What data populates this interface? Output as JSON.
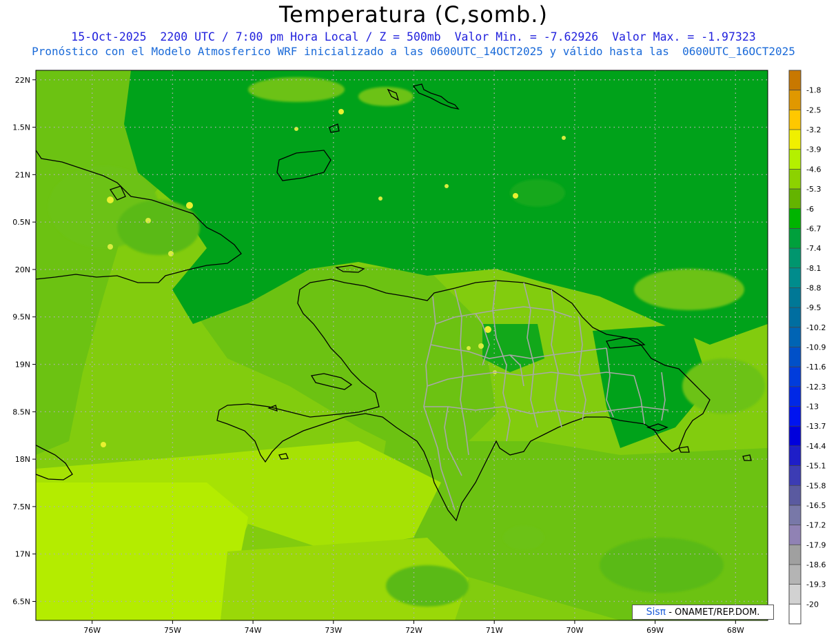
{
  "title": "Temperatura (C,somb.)",
  "subtitle_line1": "15-Oct-2025  2200 UTC / 7:00 pm Hora Local / Z = 500mb  Valor Min. = -7.62926  Valor Max. = -1.97323",
  "subtitle_line2": "Pronóstico con el Modelo Atmosferico WRF inicializado a las 0600UTC_14OCT2025 y válido hasta las  0600UTC_16OCT2025",
  "credit_brand": "Sisπ",
  "credit_text": " - ONAMET/REP.DOM.",
  "map": {
    "lon_range": [
      -76.7,
      -67.6
    ],
    "lat_range": [
      16.3,
      22.1
    ],
    "lat_ticks": [
      {
        "value": 22.0,
        "label": "22N"
      },
      {
        "value": 21.5,
        "label": "1.5N"
      },
      {
        "value": 21.0,
        "label": "21N"
      },
      {
        "value": 20.5,
        "label": "0.5N"
      },
      {
        "value": 20.0,
        "label": "20N"
      },
      {
        "value": 19.5,
        "label": "9.5N"
      },
      {
        "value": 19.0,
        "label": "19N"
      },
      {
        "value": 18.5,
        "label": "8.5N"
      },
      {
        "value": 18.0,
        "label": "18N"
      },
      {
        "value": 17.5,
        "label": "7.5N"
      },
      {
        "value": 17.0,
        "label": "17N"
      },
      {
        "value": 16.5,
        "label": "6.5N"
      }
    ],
    "lon_ticks": [
      {
        "value": -76,
        "label": "76W"
      },
      {
        "value": -75,
        "label": "75W"
      },
      {
        "value": -74,
        "label": "74W"
      },
      {
        "value": -73,
        "label": "73W"
      },
      {
        "value": -72,
        "label": "72W"
      },
      {
        "value": -71,
        "label": "71W"
      },
      {
        "value": -70,
        "label": "70W"
      },
      {
        "value": -69,
        "label": "69W"
      },
      {
        "value": -68,
        "label": "68W"
      }
    ],
    "grid": true,
    "colors": {
      "dark": "#00a21a",
      "mid": "#5aba12",
      "light": "#82cc0e",
      "lighter": "#a6e204",
      "lightest": "#b4ec00",
      "hot": "#e8f030",
      "coast": "#000000",
      "provinces": "#a8a8a8"
    }
  },
  "colorbar": {
    "labels": [
      "-1.8",
      "-2.5",
      "-3.2",
      "-3.9",
      "-4.6",
      "-5.3",
      "-6",
      "-6.7",
      "-7.4",
      "-8.1",
      "-8.8",
      "-9.5",
      "-10.2",
      "-10.9",
      "-11.6",
      "-12.3",
      "-13",
      "-13.7",
      "-14.4",
      "-15.1",
      "-15.8",
      "-16.5",
      "-17.2",
      "-17.9",
      "-18.6",
      "-19.3",
      "-20"
    ],
    "colors": [
      "#c87800",
      "#e09800",
      "#ffc800",
      "#f0f000",
      "#b4f000",
      "#8cd200",
      "#64b400",
      "#00b400",
      "#00a03c",
      "#00966e",
      "#008c8c",
      "#007896",
      "#006ea0",
      "#0064b4",
      "#0050c8",
      "#003cdc",
      "#0028e6",
      "#0014f0",
      "#0000dc",
      "#1e1ec8",
      "#3c3cb4",
      "#5a5aa0",
      "#7878a8",
      "#9082b4",
      "#a0a0a0",
      "#b4b4b4",
      "#d2d2d2",
      "#ffffff"
    ]
  }
}
